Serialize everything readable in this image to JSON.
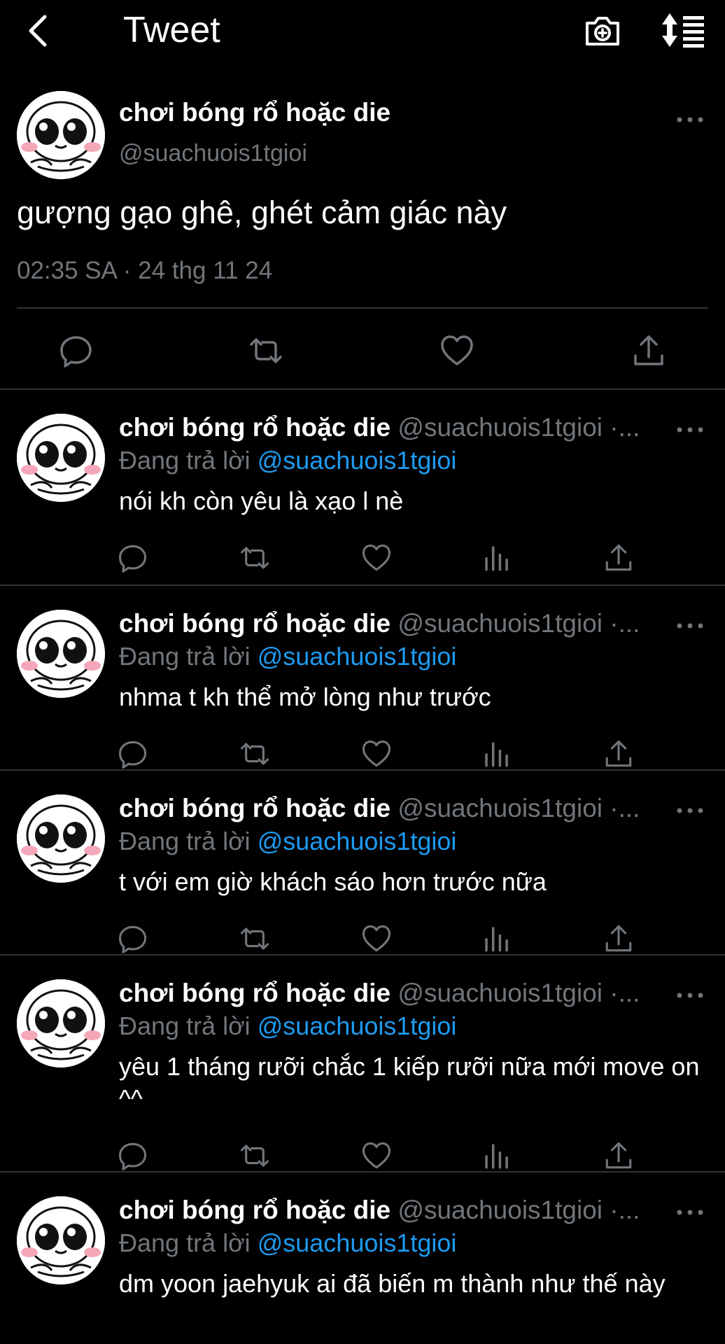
{
  "header": {
    "title": "Tweet",
    "back_icon": "chevron-left-icon",
    "camera_icon": "camera-plus-icon",
    "sort_icon": "sort-list-icon"
  },
  "main_tweet": {
    "name": "chơi bóng rổ hoặc die",
    "handle": "@suachuois1tgioi",
    "text": "gượng gạo ghê, ghét cảm giác này",
    "timestamp": "02:35 SA · 24 thg 11 24"
  },
  "replies": [
    {
      "name": "chơi bóng rổ hoặc die",
      "handle": "@suachuois1tgioi ·...",
      "replying_prefix": "Đang trả lời",
      "replying_to": "@suachuois1tgioi",
      "text": "nói kh còn yêu là xạo l nè"
    },
    {
      "name": "chơi bóng rổ hoặc die",
      "handle": "@suachuois1tgioi ·...",
      "replying_prefix": "Đang trả lời",
      "replying_to": "@suachuois1tgioi",
      "text": "nhma t kh thể mở lòng như trước"
    },
    {
      "name": "chơi bóng rổ hoặc die",
      "handle": "@suachuois1tgioi ·...",
      "replying_prefix": "Đang trả lời",
      "replying_to": "@suachuois1tgioi",
      "text": "t với em giờ khách sáo hơn trước nữa"
    },
    {
      "name": "chơi bóng rổ hoặc die",
      "handle": "@suachuois1tgioi ·...",
      "replying_prefix": "Đang trả lời",
      "replying_to": "@suachuois1tgioi",
      "text": "yêu 1 tháng rưỡi chắc 1 kiếp rưỡi nữa mới move on ^^"
    },
    {
      "name": "chơi bóng rổ hoặc die",
      "handle": "@suachuois1tgioi ·...",
      "replying_prefix": "Đang trả lời",
      "replying_to": "@suachuois1tgioi",
      "text": "dm yoon jaehyuk ai đã biến m thành như thế này"
    }
  ],
  "colors": {
    "background": "#000000",
    "text": "#ffffff",
    "muted": "#71767b",
    "link": "#1d9bf0",
    "divider": "#2f3336"
  }
}
